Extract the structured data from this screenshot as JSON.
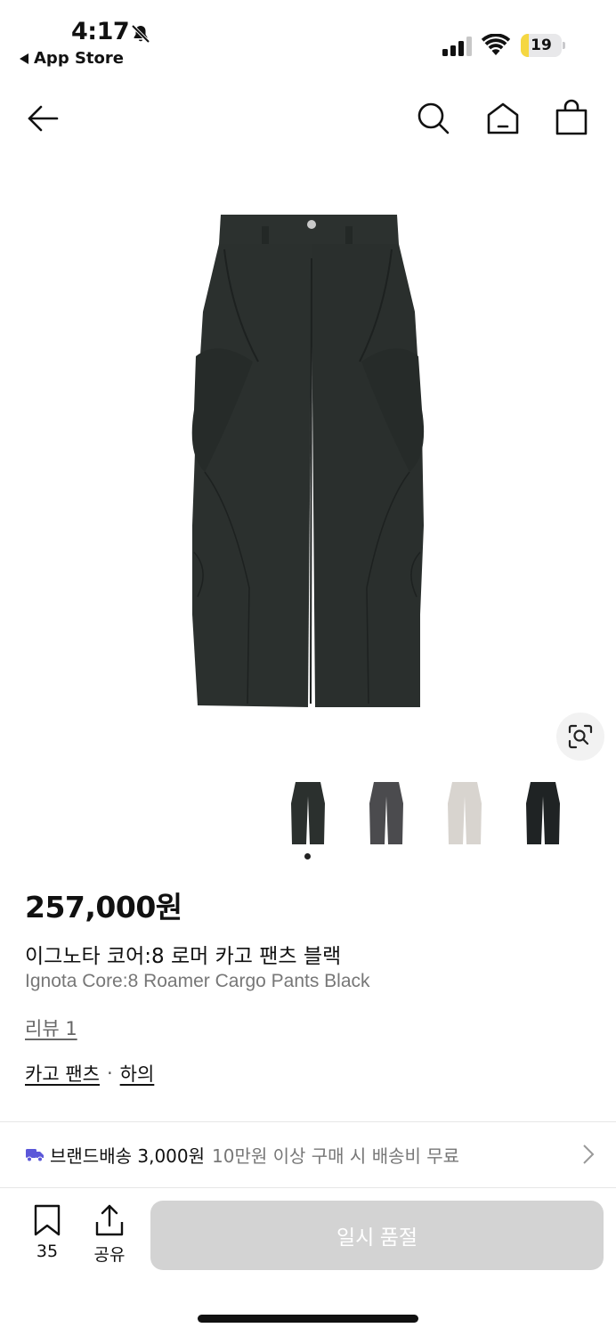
{
  "status_bar": {
    "time": "4:17",
    "back_app": "App Store",
    "battery_level": "19",
    "battery_fraction": 0.19,
    "colors": {
      "battery_fill": "#f5d742"
    }
  },
  "nav": {
    "icons": [
      "arrow-left-icon",
      "search-icon",
      "home-icon",
      "shopping-bag-icon"
    ]
  },
  "product": {
    "price": "257,000원",
    "name_kr": "이그노타 코어:8 로머 카고 팬츠 블랙",
    "name_en": "Ignota Core:8 Roamer Cargo Pants Black",
    "review_link": "리뷰 1",
    "category": [
      "카고 팬츠",
      "하의"
    ],
    "category_separator": "·",
    "image_colors": [
      "#2b302e",
      "#4b4b4e",
      "#d8d4cf",
      "#1f2324"
    ],
    "selected_thumb_index": 0
  },
  "shipping": {
    "title": "브랜드배송 3,000원",
    "subtitle": "10만원 이상 구매 시 배송비 무료",
    "colors": {
      "truck": "#5b57d9"
    }
  },
  "bottom_bar": {
    "bookmark_count": "35",
    "share_label": "공유",
    "buy_button_label": "일시 품절"
  }
}
